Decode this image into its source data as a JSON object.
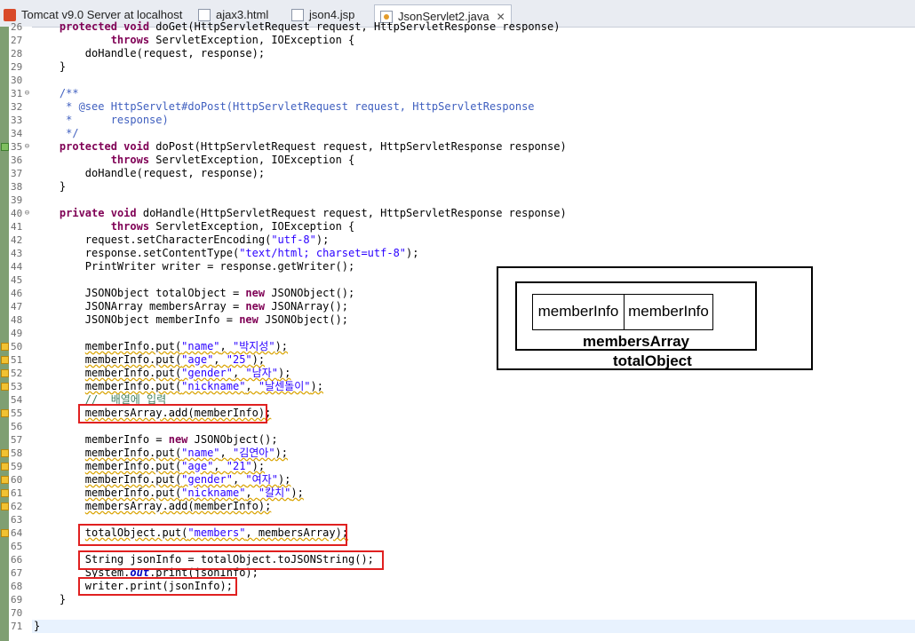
{
  "tabs": [
    {
      "label": "Tomcat v9.0 Server at localhost",
      "icon": "server-icon"
    },
    {
      "label": "ajax3.html",
      "icon": "html-file-icon"
    },
    {
      "label": "json4.jsp",
      "icon": "jsp-file-icon"
    },
    {
      "label": "JsonServlet2.java",
      "icon": "java-file-icon",
      "active": true,
      "close": "✕"
    }
  ],
  "lines": [
    {
      "n": "26",
      "html": "    <span class=\"kw\">protected</span> <span class=\"kw\">void</span> doGet(HttpServletRequest request, HttpServletResponse response)"
    },
    {
      "n": "27",
      "html": "            <span class=\"kw\">throws</span> ServletException, IOException {"
    },
    {
      "n": "28",
      "html": "        doHandle(request, response);"
    },
    {
      "n": "29",
      "html": "    }"
    },
    {
      "n": "30",
      "html": ""
    },
    {
      "n": "31",
      "html": "    <span class=\"cmt\">/**</span>",
      "fold": "⊖"
    },
    {
      "n": "32",
      "html": "<span class=\"cmt\">     * @see HttpServlet#doPost(HttpServletRequest request, HttpServletResponse</span>"
    },
    {
      "n": "33",
      "html": "<span class=\"cmt\">     *      response)</span>"
    },
    {
      "n": "34",
      "html": "<span class=\"cmt\">     */</span>"
    },
    {
      "n": "35",
      "html": "    <span class=\"kw\">protected</span> <span class=\"kw\">void</span> doPost(HttpServletRequest request, HttpServletResponse response)",
      "fold": "⊖",
      "override": true
    },
    {
      "n": "36",
      "html": "            <span class=\"kw\">throws</span> ServletException, IOException {"
    },
    {
      "n": "37",
      "html": "        doHandle(request, response);"
    },
    {
      "n": "38",
      "html": "    }"
    },
    {
      "n": "39",
      "html": ""
    },
    {
      "n": "40",
      "html": "    <span class=\"kw\">private</span> <span class=\"kw\">void</span> doHandle(HttpServletRequest request, HttpServletResponse response)",
      "fold": "⊖"
    },
    {
      "n": "41",
      "html": "            <span class=\"kw\">throws</span> ServletException, IOException {"
    },
    {
      "n": "42",
      "html": "        request.setCharacterEncoding(<span class=\"str\">\"utf-8\"</span>);"
    },
    {
      "n": "43",
      "html": "        response.setContentType(<span class=\"str\">\"text/html; charset=utf-8\"</span>);"
    },
    {
      "n": "44",
      "html": "        PrintWriter writer = response.getWriter();"
    },
    {
      "n": "45",
      "html": ""
    },
    {
      "n": "46",
      "html": "        JSONObject totalObject = <span class=\"kw\">new</span> JSONObject();"
    },
    {
      "n": "47",
      "html": "        JSONArray membersArray = <span class=\"kw\">new</span> JSONArray();"
    },
    {
      "n": "48",
      "html": "        JSONObject memberInfo = <span class=\"kw\">new</span> JSONObject();"
    },
    {
      "n": "49",
      "html": ""
    },
    {
      "n": "50",
      "html": "        <span class=\"sq\">memberInfo.put(<span class=\"str\">\"name\"</span>, <span class=\"str\">\"박지성\"</span>);</span>",
      "warn": true
    },
    {
      "n": "51",
      "html": "        <span class=\"sq\">memberInfo.put(<span class=\"str\">\"age\"</span>, <span class=\"str\">\"25\"</span>);</span>",
      "warn": true
    },
    {
      "n": "52",
      "html": "        <span class=\"sq\">memberInfo.put(<span class=\"str\">\"gender\"</span>, <span class=\"str\">\"남자\"</span>);</span>",
      "warn": true
    },
    {
      "n": "53",
      "html": "        <span class=\"sq\">memberInfo.put(<span class=\"str\">\"nickname\"</span>, <span class=\"str\">\"날센돌이\"</span>);</span>",
      "warn": true
    },
    {
      "n": "54",
      "html": "        <span class=\"lcm\">//  배열에 입력</span>"
    },
    {
      "n": "55",
      "html": "        <span class=\"sq\">membersArray.add(memberInfo);</span>",
      "warn": true
    },
    {
      "n": "56",
      "html": ""
    },
    {
      "n": "57",
      "html": "        memberInfo = <span class=\"kw\">new</span> JSONObject();"
    },
    {
      "n": "58",
      "html": "        <span class=\"sq\">memberInfo.put(<span class=\"str\">\"name\"</span>, <span class=\"str\">\"김연아\"</span>);</span>",
      "warn": true
    },
    {
      "n": "59",
      "html": "        <span class=\"sq\">memberInfo.put(<span class=\"str\">\"age\"</span>, <span class=\"str\">\"21\"</span>);</span>",
      "warn": true
    },
    {
      "n": "60",
      "html": "        <span class=\"sq\">memberInfo.put(<span class=\"str\">\"gender\"</span>, <span class=\"str\">\"여자\"</span>);</span>",
      "warn": true
    },
    {
      "n": "61",
      "html": "        <span class=\"sq\">memberInfo.put(<span class=\"str\">\"nickname\"</span>, <span class=\"str\">\"칼치\"</span>);</span>",
      "warn": true
    },
    {
      "n": "62",
      "html": "        <span class=\"sq\">membersArray.add(memberInfo);</span>",
      "warn": true
    },
    {
      "n": "63",
      "html": ""
    },
    {
      "n": "64",
      "html": "        <span class=\"sq\">totalObject.put(<span class=\"str\">\"members\"</span>, membersArray);</span>",
      "warn": true
    },
    {
      "n": "65",
      "html": ""
    },
    {
      "n": "66",
      "html": "        String jsonInfo = totalObject.toJSONString();"
    },
    {
      "n": "67",
      "html": "        System.<span class=\"fld\">out</span>.print(jsonInfo);"
    },
    {
      "n": "68",
      "html": "        writer.print(jsonInfo);"
    },
    {
      "n": "69",
      "html": "    }"
    },
    {
      "n": "70",
      "html": ""
    },
    {
      "n": "71",
      "html": "}"
    }
  ],
  "diagram": {
    "cell1": "memberInfo",
    "cell2": "memberInfo",
    "array_label": "membersArray",
    "object_label": "totalObject"
  }
}
